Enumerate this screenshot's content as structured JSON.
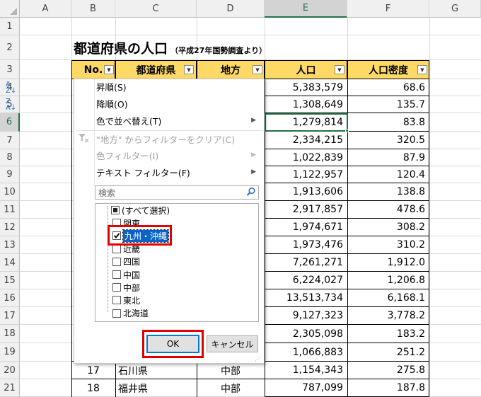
{
  "columns": [
    "A",
    "B",
    "C",
    "D",
    "E",
    "F",
    "G"
  ],
  "selected_column": "E",
  "rows": [
    "1",
    "2",
    "3",
    "4",
    "5",
    "6",
    "7",
    "8",
    "9",
    "10",
    "11",
    "12",
    "13",
    "14",
    "15",
    "16",
    "17",
    "18",
    "19",
    "20",
    "21"
  ],
  "selected_row": "6",
  "sheet_title": "都道府県の人口",
  "sheet_subtitle": "（平成27年国勢調査より）",
  "table_headers": {
    "no": "No.",
    "pref": "都道府県",
    "region": "地方",
    "pop": "人口",
    "density": "人口密度"
  },
  "population": [
    "5,383,579",
    "1,308,649",
    "1,279,814",
    "2,334,215",
    "1,022,839",
    "1,122,957",
    "1,913,606",
    "2,917,857",
    "1,974,671",
    "1,973,476",
    "7,261,271",
    "6,224,027",
    "13,513,734",
    "9,127,323",
    "2,305,098",
    "1,066,883",
    "1,154,343",
    "787,099"
  ],
  "density": [
    "68.6",
    "135.7",
    "83.8",
    "320.5",
    "87.9",
    "120.4",
    "138.8",
    "478.6",
    "308.2",
    "310.2",
    "1,912.0",
    "1,206.8",
    "6,168.1",
    "3,778.2",
    "183.2",
    "251.2",
    "275.8",
    "187.8"
  ],
  "visible_rows": [
    {
      "no": "17",
      "pref": "石川県",
      "region": "中部"
    },
    {
      "no": "18",
      "pref": "福井県",
      "region": "中部"
    }
  ],
  "menu": {
    "sort_asc": "昇順(S)",
    "sort_desc": "降順(O)",
    "sort_color": "色で並べ替え(T)",
    "clear_filter": "\"地方\" からフィルターをクリア(C)",
    "color_filter": "色フィルター(I)",
    "text_filter": "テキスト フィルター(F)"
  },
  "search_placeholder": "検索",
  "filter_items": [
    {
      "label": "(すべて選択)",
      "state": "mixed"
    },
    {
      "label": "関東",
      "state": "unchecked"
    },
    {
      "label": "九州・沖縄",
      "state": "checked"
    },
    {
      "label": "近畿",
      "state": "unchecked"
    },
    {
      "label": "四国",
      "state": "unchecked"
    },
    {
      "label": "中国",
      "state": "unchecked"
    },
    {
      "label": "中部",
      "state": "unchecked"
    },
    {
      "label": "東北",
      "state": "unchecked"
    },
    {
      "label": "北海道",
      "state": "unchecked"
    }
  ],
  "buttons": {
    "ok": "OK",
    "cancel": "キャンセル"
  },
  "icons": {
    "search": "search-icon",
    "filter_clear": "funnel-clear-icon",
    "sort_asc": "sort-az-icon",
    "sort_desc": "sort-za-icon"
  },
  "colors": {
    "header_fill": "#ffd966",
    "highlight": "#e00000",
    "selection": "#217346"
  }
}
